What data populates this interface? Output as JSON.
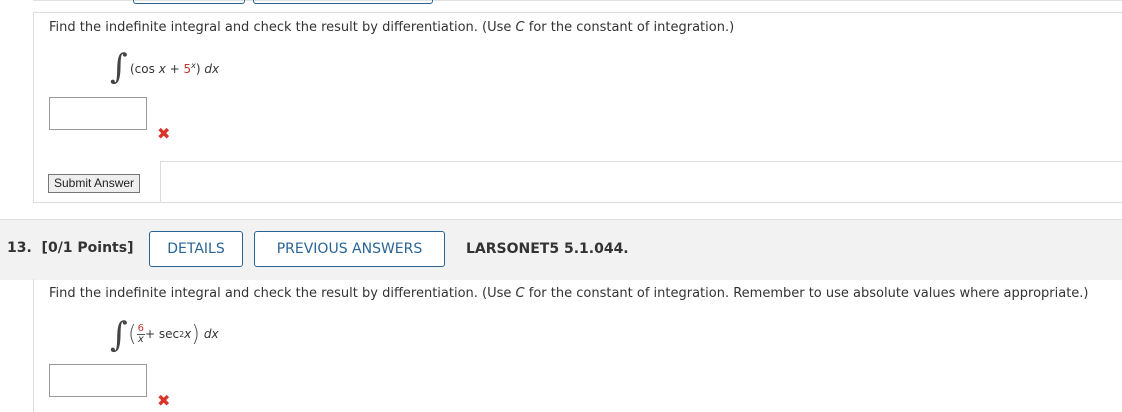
{
  "question12": {
    "prompt_a": "Find the indefinite integral and check the result by differentiation. (Use ",
    "prompt_c": "C",
    "prompt_b": " for the constant of integration.)",
    "integrand_prefix": "(cos ",
    "integrand_x": "x",
    "integrand_plus": " + ",
    "integrand_base": "5",
    "integrand_exp": "x",
    "integrand_suffix": ") ",
    "integrand_dx": "dx",
    "answer_value": "",
    "mark": "✖",
    "submit_label": "Submit Answer"
  },
  "question13": {
    "number_label": "13.  [0/1 Points]",
    "details_label": "DETAILS",
    "previous_label": "PREVIOUS ANSWERS",
    "reference": "LARSONET5 5.1.044.",
    "prompt_a": "Find the indefinite integral and check the result by differentiation. (Use ",
    "prompt_c": "C",
    "prompt_b": " for the constant of integration. Remember to use absolute values where appropriate.)",
    "frac_num": "6",
    "frac_den": "x",
    "plus": " + sec",
    "sec_exp": "2",
    "sec_var": " x",
    "dx": "dx",
    "answer_value": "",
    "mark": "✖"
  },
  "colors": {
    "accent": "#2a6496",
    "error": "#d9342b",
    "header_bg": "#f2f2f2"
  }
}
